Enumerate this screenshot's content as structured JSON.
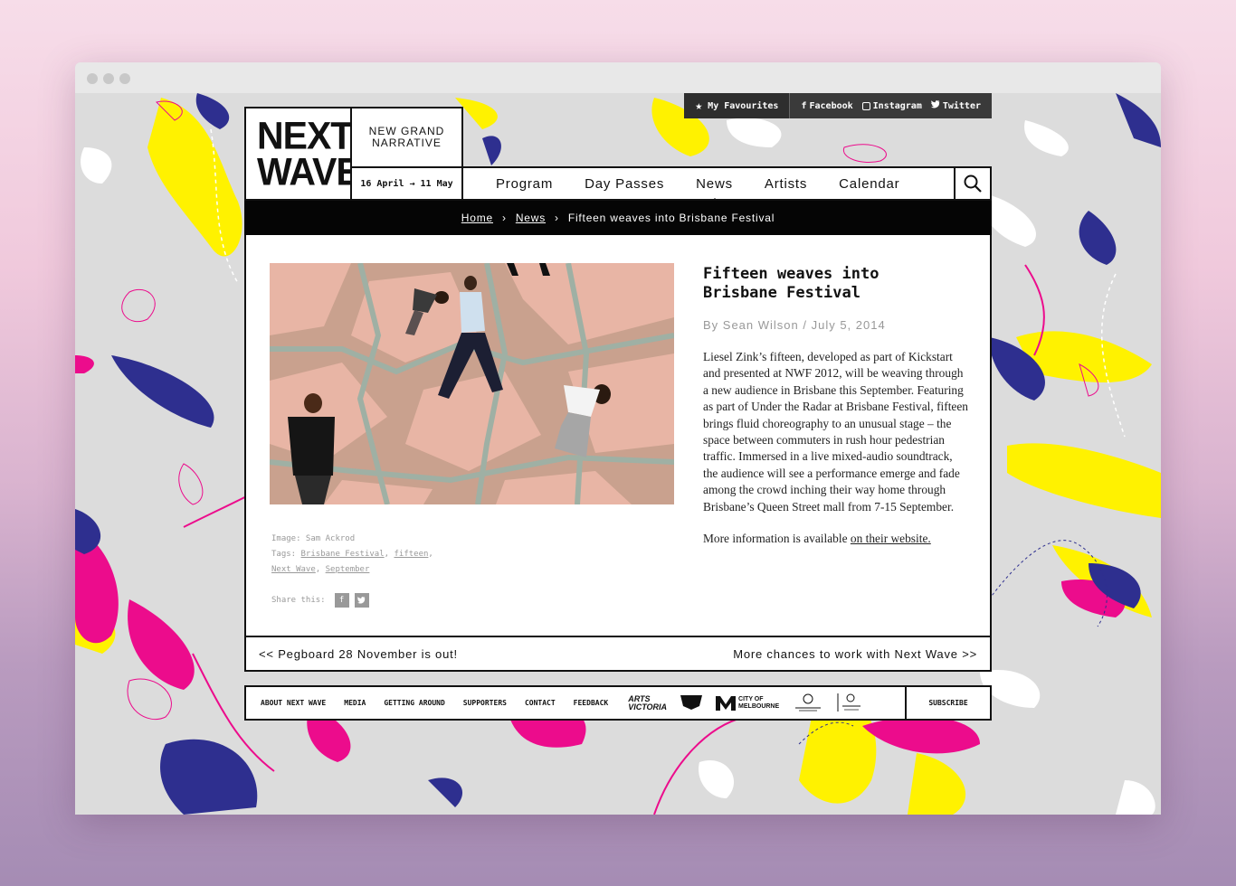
{
  "topbar": {
    "favourites": "My Favourites",
    "facebook": "Facebook",
    "instagram": "Instagram",
    "twitter": "Twitter"
  },
  "header": {
    "logo_line1": "NEXT",
    "logo_line2": "WAVE",
    "tagline_line1": "NEW GRAND",
    "tagline_line2": "NARRATIVE",
    "dates": "16 April → 11 May"
  },
  "nav": {
    "items": [
      "Program",
      "Day Passes",
      "News",
      "Artists",
      "Calendar"
    ],
    "active": "News"
  },
  "breadcrumb": {
    "home": "Home",
    "news": "News",
    "current": "Fifteen weaves into Brisbane Festival",
    "separator": "›"
  },
  "article": {
    "title": "Fifteen weaves into Brisbane Festival",
    "byline": "By Sean Wilson / July 5, 2014",
    "paragraph1": "Liesel Zink’s fifteen, developed as part of Kickstart and presented at NWF 2012, will be weaving through a new audience in Brisbane this September. Featuring as part of Under the Radar at Brisbane Festival, fifteen brings fluid choreography to an unusual stage – the space between commuters in rush hour pedestrian traffic. Immersed in a live mixed-audio soundtrack, the audience will see a performance emerge and fade among the crowd inching their way home through Brisbane’s Queen Street mall from 7-15 September.",
    "paragraph2_prefix": "More information is available ",
    "paragraph2_link": "on their website.",
    "image_credit": "Image: Sam Ackrod",
    "tags_label": "Tags:",
    "tags": [
      "Brisbane Festival",
      "fifteen",
      "Next Wave",
      "September"
    ],
    "share_label": "Share this:"
  },
  "pager": {
    "prev": "<< Pegboard 28 November is out!",
    "next": "More chances to work with Next Wave >>"
  },
  "footer": {
    "links": [
      "ABOUT NEXT WAVE",
      "MEDIA",
      "GETTING AROUND",
      "SUPPORTERS",
      "CONTACT",
      "FEEDBACK"
    ],
    "subscribe": "SUBSCRIBE",
    "sponsor_arts_line1": "ARTS",
    "sponsor_arts_line2": "VICTORIA",
    "sponsor_city_line1": "CITY OF",
    "sponsor_city_line2": "MELBOURNE"
  },
  "colors": {
    "splash_yellow": "#fff200",
    "splash_magenta": "#ec0c8c",
    "splash_navy": "#2e2f8f",
    "background": "#dcdcdc"
  }
}
